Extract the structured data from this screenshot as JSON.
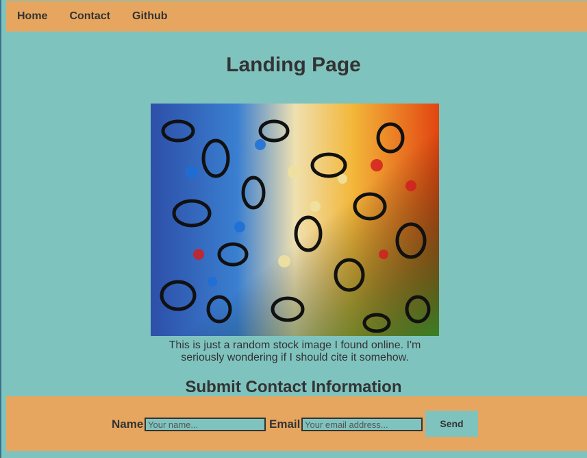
{
  "nav": {
    "links": [
      {
        "label": "Home"
      },
      {
        "label": "Contact"
      },
      {
        "label": "Github"
      }
    ]
  },
  "main": {
    "title": "Landing Page",
    "image_caption": "This is just a random stock image I found online. I'm seriously wondering if I should cite it somehow.",
    "section_title": "Submit Contact Information"
  },
  "form": {
    "name_label": "Name",
    "name_placeholder": "Your name...",
    "email_label": "Email",
    "email_placeholder": "Your email address...",
    "send_label": "Send"
  },
  "colors": {
    "background": "#7fc3bf",
    "accent": "#e6a65f",
    "text": "#333333"
  }
}
